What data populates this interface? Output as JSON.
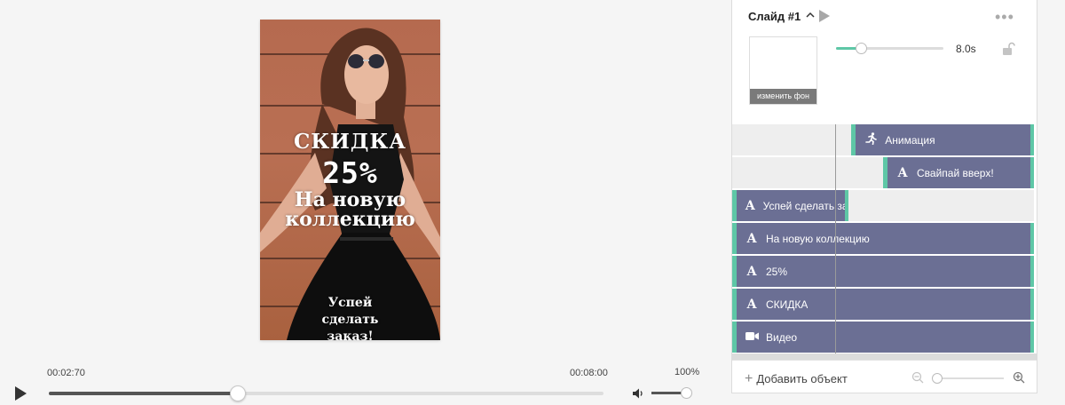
{
  "preview": {
    "overlay_sale": "СКИДКА",
    "overlay_percent": "25%",
    "overlay_new": "На новую коллекцию",
    "overlay_hurry": "Успей сделать заказ!"
  },
  "player": {
    "current_time": "00:02:70",
    "duration": "00:08:00",
    "progress_fraction": 0.34,
    "volume_label": "100%",
    "volume_fraction": 1.0
  },
  "slide": {
    "title": "Слайд #1",
    "change_bg_label": "изменить фон",
    "duration_value": "8.0s",
    "duration_fraction": 0.23
  },
  "timeline": {
    "rows": [
      {
        "label": "Анимация",
        "icon": "running-person-icon",
        "start": 0.395,
        "end": 1.0
      },
      {
        "label": "Свайпай вверх!",
        "icon": "text-icon",
        "start": 0.5,
        "end": 1.0
      },
      {
        "label": "Успей сделать заказ!",
        "icon": "text-icon",
        "start": 0.0,
        "end": 0.385
      },
      {
        "label": "На новую коллекцию",
        "icon": "text-icon",
        "start": 0.0,
        "end": 1.0
      },
      {
        "label": "25%",
        "icon": "text-icon",
        "start": 0.0,
        "end": 1.0
      },
      {
        "label": "СКИДКА",
        "icon": "text-icon",
        "start": 0.0,
        "end": 1.0
      },
      {
        "label": "Видео",
        "icon": "video-camera-icon",
        "start": 0.0,
        "end": 1.0
      }
    ],
    "add_object_label": "Добавить объект",
    "zoom_fraction": 0.0
  },
  "colors": {
    "accent": "#5ec7a6",
    "bar": "#6b6f94",
    "text_dark": "#333333"
  }
}
